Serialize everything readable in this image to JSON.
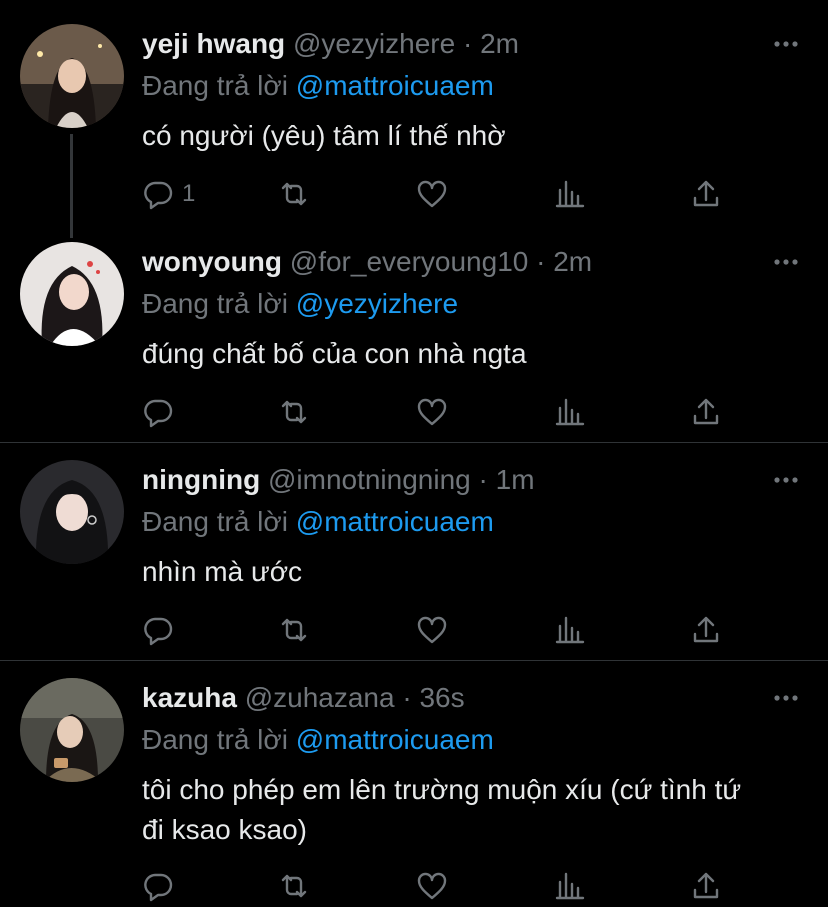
{
  "replies": [
    {
      "name": "yeji hwang",
      "handle": "@yezyizhere",
      "separator": "·",
      "time": "2m",
      "replying_label": "Đang trả lời",
      "replying_to": "@mattroicuaem",
      "text": "có người (yêu) tâm lí thế nhờ",
      "reply_count": "1"
    },
    {
      "name": "wonyoung",
      "handle": "@for_everyoung10",
      "separator": "·",
      "time": "2m",
      "replying_label": "Đang trả lời",
      "replying_to": "@yezyizhere",
      "text": "đúng chất bố của con nhà ngta",
      "reply_count": ""
    },
    {
      "name": "ningning",
      "handle": "@imnotningning",
      "separator": "·",
      "time": "1m",
      "replying_label": "Đang trả lời",
      "replying_to": "@mattroicuaem",
      "text": "nhìn mà ước",
      "reply_count": ""
    },
    {
      "name": "kazuha",
      "handle": "@zuhazana",
      "separator": "·",
      "time": "36s",
      "replying_label": "Đang trả lời",
      "replying_to": "@mattroicuaem",
      "text": "tôi cho phép em lên trường muộn xíu (cứ tình tứ đi ksao ksao)",
      "reply_count": ""
    }
  ],
  "icons": {
    "more": "more-horizontal-icon",
    "reply": "reply-bubble-icon",
    "retweet": "retweet-icon",
    "like": "heart-icon",
    "analytics": "analytics-bars-icon",
    "share": "share-upload-icon"
  },
  "colors": {
    "background": "#000000",
    "text": "#e7e9ea",
    "secondary": "#71767b",
    "link": "#1d9bf0",
    "divider": "#2f3336"
  }
}
